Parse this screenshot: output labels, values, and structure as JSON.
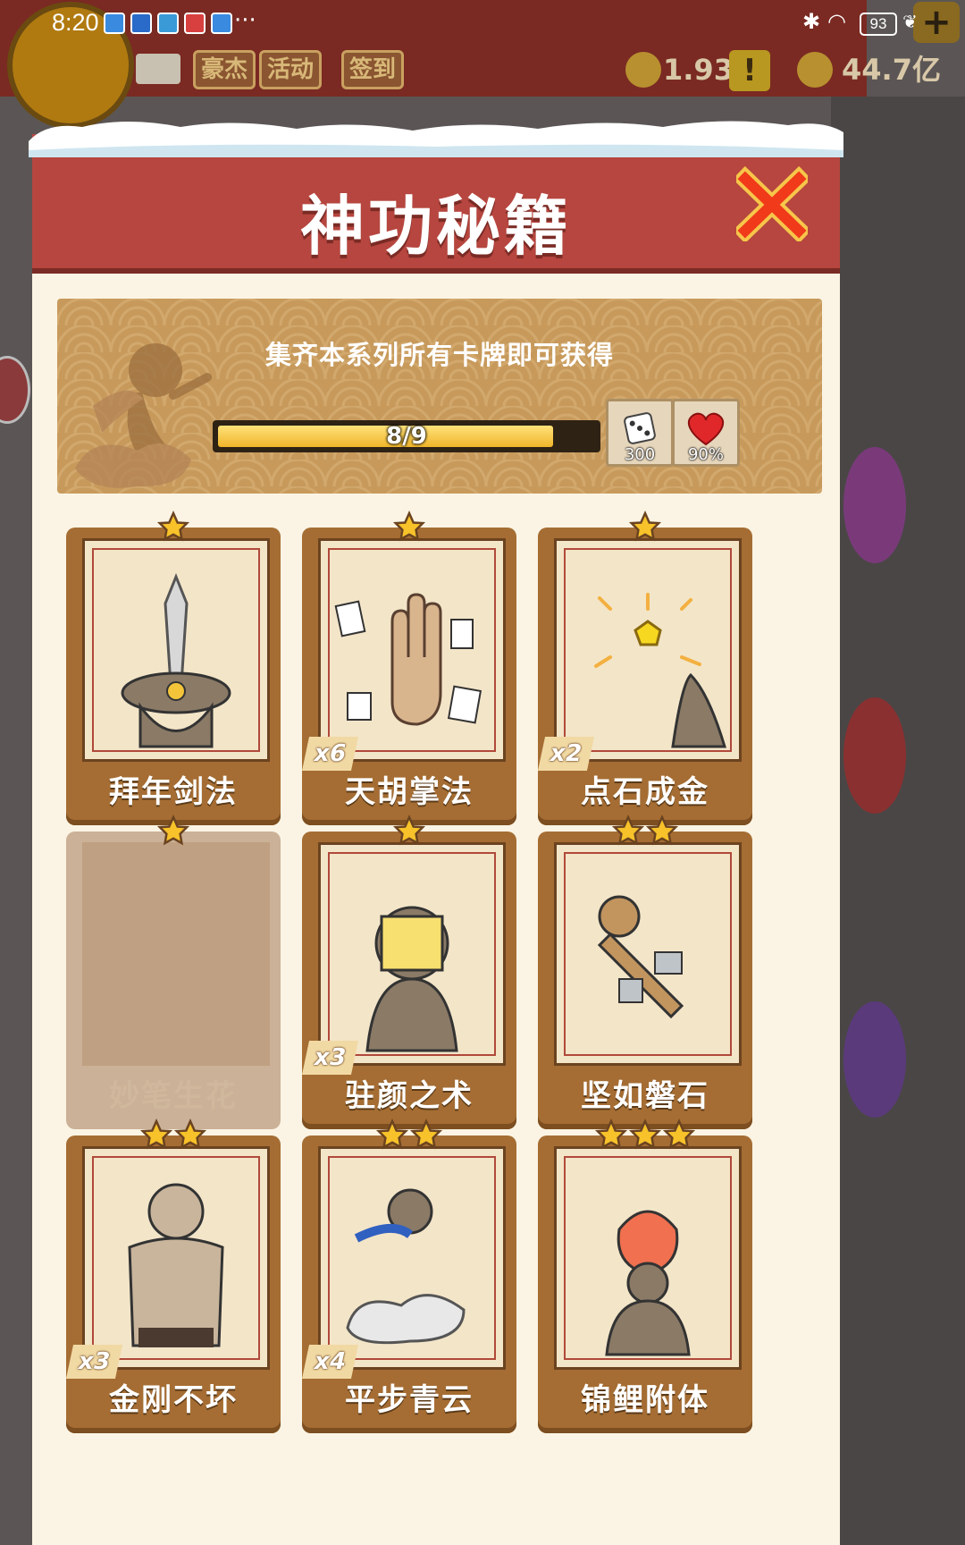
{
  "status_bar": {
    "time": "8:20",
    "overflow": "···",
    "battery": "93"
  },
  "background": {
    "buttons": [
      "豪杰",
      "活动",
      "签到"
    ],
    "currency_1": "1.93万",
    "currency_2": "44.7亿",
    "alert": "!"
  },
  "modal": {
    "title": "神功秘籍",
    "banner": {
      "text": "集齐本系列所有卡牌即可获得",
      "progress_label": "8/9",
      "progress_current": 8,
      "progress_total": 9,
      "rewards": [
        {
          "icon": "dice-icon",
          "amount": "300"
        },
        {
          "icon": "heart-icon",
          "amount": "90%"
        }
      ]
    },
    "cards": [
      {
        "name": "拜年剑法",
        "stars": 1,
        "count": "",
        "locked": false,
        "art": "sword"
      },
      {
        "name": "天胡掌法",
        "stars": 1,
        "count": "x6",
        "locked": false,
        "art": "palm"
      },
      {
        "name": "点石成金",
        "stars": 1,
        "count": "x2",
        "locked": false,
        "art": "gold"
      },
      {
        "name": "妙笔生花",
        "stars": 1,
        "count": "",
        "locked": true,
        "art": "none"
      },
      {
        "name": "驻颜之术",
        "stars": 1,
        "count": "x3",
        "locked": false,
        "art": "mask"
      },
      {
        "name": "坚如磐石",
        "stars": 2,
        "count": "",
        "locked": false,
        "art": "rock"
      },
      {
        "name": "金刚不坏",
        "stars": 2,
        "count": "x3",
        "locked": false,
        "art": "muscle"
      },
      {
        "name": "平步青云",
        "stars": 2,
        "count": "x4",
        "locked": false,
        "art": "cloud"
      },
      {
        "name": "锦鲤附体",
        "stars": 3,
        "count": "",
        "locked": false,
        "art": "koi"
      }
    ]
  },
  "colors": {
    "header": "#b6463f",
    "card": "#a56d33",
    "progress": "#f0b52a",
    "close": "#f03a1a"
  }
}
